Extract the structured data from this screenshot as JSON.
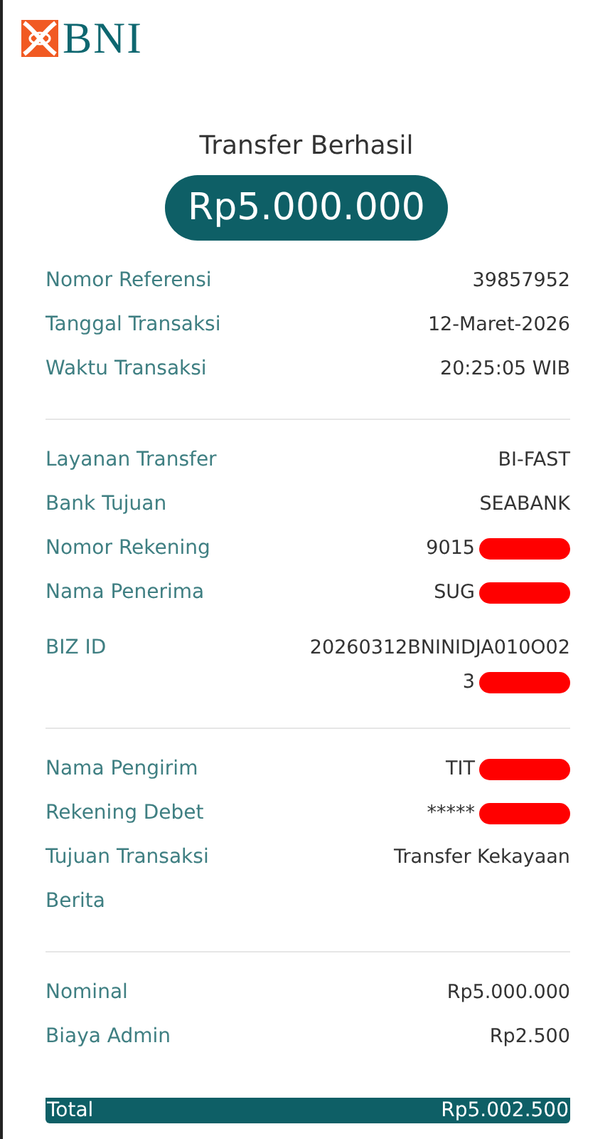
{
  "logo": {
    "text": "BNI"
  },
  "title": "Transfer Berhasil",
  "amount": "Rp5.000.000",
  "sections": [
    {
      "rows": [
        {
          "label": "Nomor Referensi",
          "value": "39857952"
        },
        {
          "label": "Tanggal Transaksi",
          "value": "12-Maret-2026"
        },
        {
          "label": "Waktu Transaksi",
          "value": "20:25:05 WIB"
        }
      ]
    },
    {
      "rows": [
        {
          "label": "Layanan Transfer",
          "value": "BI-FAST"
        },
        {
          "label": "Bank Tujuan",
          "value": "SEABANK"
        },
        {
          "label": "Nomor Rekening",
          "value": "9015",
          "redacted": true
        },
        {
          "label": "Nama Penerima",
          "value": "SUG",
          "redacted": true
        },
        {
          "label": "BIZ ID",
          "value": "20260312BNINIDJA010O02",
          "value_2": "3",
          "redacted": true
        }
      ]
    },
    {
      "rows": [
        {
          "label": "Nama Pengirim",
          "value": "TIT",
          "redacted": true
        },
        {
          "label": "Rekening Debet",
          "value": "*****",
          "redacted": true
        },
        {
          "label": "Tujuan Transaksi",
          "value": "Transfer Kekayaan"
        },
        {
          "label": "Berita"
        }
      ]
    },
    {
      "rows": [
        {
          "label": "Nominal",
          "value": "Rp5.000.000"
        },
        {
          "label": "Biaya Admin",
          "value": "Rp2.500"
        }
      ]
    }
  ],
  "total": {
    "label": "Total",
    "value": "Rp5.002.500"
  }
}
